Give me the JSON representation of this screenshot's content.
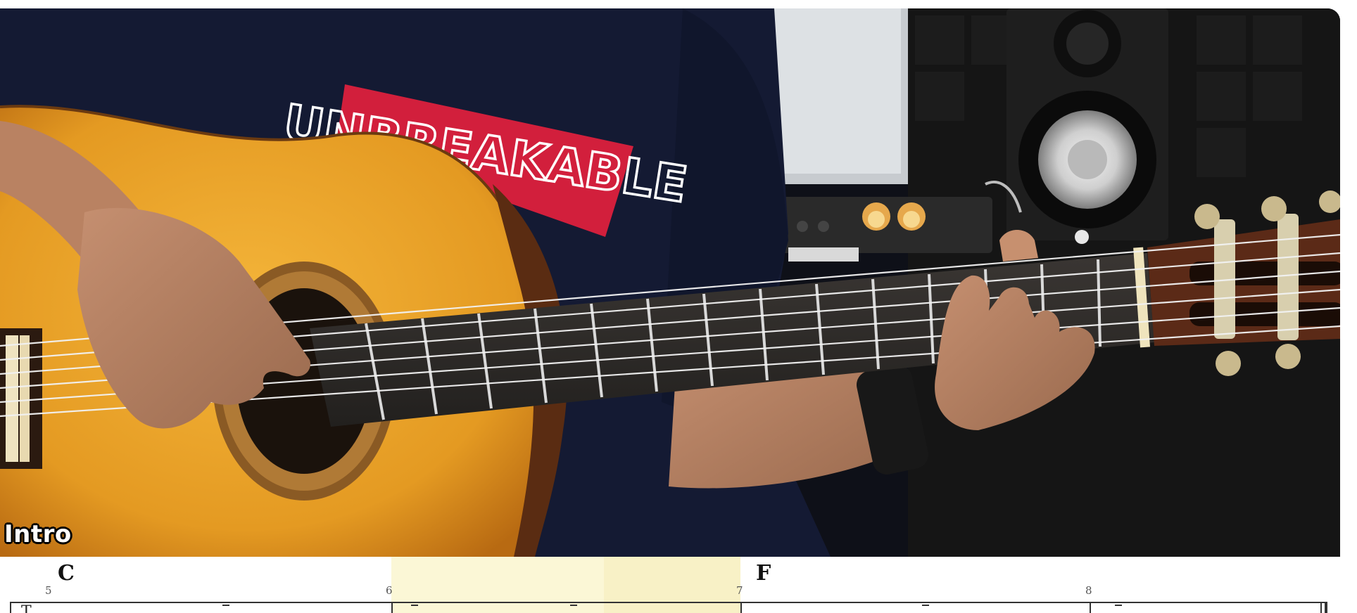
{
  "video": {
    "caption": "Intro",
    "shirt_text": "UNBREAKABLE"
  },
  "tablature": {
    "staff_label": "T",
    "measures": [
      {
        "number": "5",
        "chord": "C"
      },
      {
        "number": "6",
        "chord": ""
      },
      {
        "number": "7",
        "chord": "F"
      },
      {
        "number": "8",
        "chord": ""
      }
    ]
  },
  "colors": {
    "guitar_body": "#e5a12a",
    "shirt": "#141a33",
    "shirt_red": "#d21f3c",
    "highlight": "#fbf7d6"
  }
}
